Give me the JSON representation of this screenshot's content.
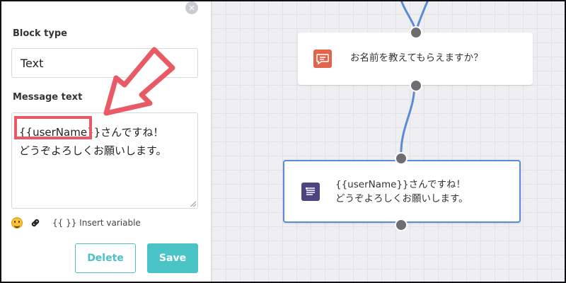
{
  "panel": {
    "close_label": "×",
    "block_type_label": "Block type",
    "block_type_value": "Text",
    "message_text_label": "Message text",
    "message_text_lines": [
      "{{userName}}さんですね！",
      "どうぞよろしくお願いします。"
    ],
    "toolbar": {
      "emoji_icon": "emoji-icon",
      "link_icon": "link-icon",
      "insert_variable_label": "{{ }} Insert variable"
    },
    "delete_label": "Delete",
    "save_label": "Save"
  },
  "canvas": {
    "node1": {
      "icon": "chat-bubble-icon",
      "text": "お名前を教えてもらえますか？"
    },
    "node2": {
      "icon": "text-lines-icon",
      "text_lines": [
        "{{userName}}さんですね！",
        "どうぞよろしくお願いします。"
      ]
    }
  },
  "colors": {
    "accent": "#4bc4c8",
    "highlight": "#e85a66",
    "node1_icon": "#e2644a",
    "node2_icon": "#4e4480",
    "wire": "#5b8bd6",
    "selected_border": "#5b8bd6"
  }
}
